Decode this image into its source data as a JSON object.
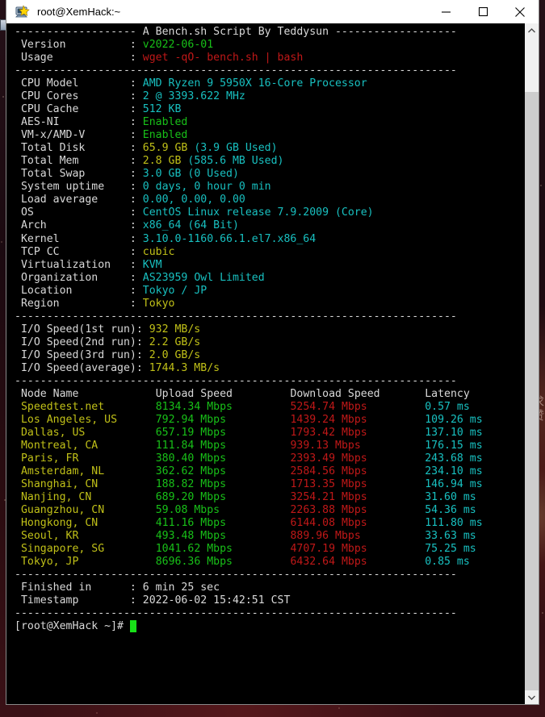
{
  "window": {
    "title": "root@XemHack:~",
    "icon": "putty-icon",
    "minimize_label": "—",
    "maximize_label": "☐",
    "close_label": "✕"
  },
  "wallpaper": {
    "watermark": "求\n赞"
  },
  "scrollbar": {
    "up_arrow": "⌃",
    "down_arrow": "⌄"
  },
  "terminal": {
    "header": {
      "separator": "-------------------",
      "title": "A Bench.sh Script By Teddysun"
    },
    "meta": [
      {
        "label": "Version",
        "value": "v2022-06-01",
        "color": "grn"
      },
      {
        "label": "Usage",
        "value": "wget -qO- bench.sh | bash",
        "color": "red"
      }
    ],
    "sysinfo": [
      {
        "label": "CPU Model",
        "value": "AMD Ryzen 9 5950X 16-Core Processor",
        "color": "cyn"
      },
      {
        "label": "CPU Cores",
        "value": "2 @ 3393.622 MHz",
        "color": "cyn"
      },
      {
        "label": "CPU Cache",
        "value": "512 KB",
        "color": "cyn"
      },
      {
        "label": "AES-NI",
        "value": "Enabled",
        "color": "grn"
      },
      {
        "label": "VM-x/AMD-V",
        "value": "Enabled",
        "color": "grn"
      },
      {
        "label": "Total Disk",
        "value": "65.9 GB",
        "color": "yel",
        "extra": "(3.9 GB Used)",
        "extra_color": "cyn"
      },
      {
        "label": "Total Mem",
        "value": "2.8 GB",
        "color": "yel",
        "extra": "(585.6 MB Used)",
        "extra_color": "cyn"
      },
      {
        "label": "Total Swap",
        "value": "3.0 GB (0 Used)",
        "color": "cyn"
      },
      {
        "label": "System uptime",
        "value": "0 days, 0 hour 0 min",
        "color": "cyn"
      },
      {
        "label": "Load average",
        "value": "0.00, 0.00, 0.00",
        "color": "cyn"
      },
      {
        "label": "OS",
        "value": "CentOS Linux release 7.9.2009 (Core)",
        "color": "cyn"
      },
      {
        "label": "Arch",
        "value": "x86_64 (64 Bit)",
        "color": "cyn"
      },
      {
        "label": "Kernel",
        "value": "3.10.0-1160.66.1.el7.x86_64",
        "color": "cyn"
      },
      {
        "label": "TCP CC",
        "value": "cubic",
        "color": "yel"
      },
      {
        "label": "Virtualization",
        "value": "KVM",
        "color": "cyn"
      },
      {
        "label": "Organization",
        "value": "AS23959 Owl Limited",
        "color": "cyn"
      },
      {
        "label": "Location",
        "value": "Tokyo / JP",
        "color": "cyn"
      },
      {
        "label": "Region",
        "value": "Tokyo",
        "color": "yel"
      }
    ],
    "io_speed": [
      {
        "label": "I/O Speed(1st run)",
        "value": "932 MB/s",
        "color": "yel"
      },
      {
        "label": "I/O Speed(2nd run)",
        "value": "2.2 GB/s",
        "color": "yel"
      },
      {
        "label": "I/O Speed(3rd run)",
        "value": "2.0 GB/s",
        "color": "yel"
      },
      {
        "label": "I/O Speed(average)",
        "value": "1744.3 MB/s",
        "color": "yel"
      }
    ],
    "speedtest": {
      "columns": [
        "Node Name",
        "Upload Speed",
        "Download Speed",
        "Latency"
      ],
      "rows": [
        {
          "node": "Speedtest.net",
          "upload": "8134.34 Mbps",
          "download": "5254.74 Mbps",
          "latency": "0.57 ms"
        },
        {
          "node": "Los Angeles, US",
          "upload": "792.94 Mbps",
          "download": "1439.24 Mbps",
          "latency": "109.26 ms"
        },
        {
          "node": "Dallas, US",
          "upload": "657.19 Mbps",
          "download": "1793.42 Mbps",
          "latency": "137.10 ms"
        },
        {
          "node": "Montreal, CA",
          "upload": "111.84 Mbps",
          "download": "939.13 Mbps",
          "latency": "176.15 ms"
        },
        {
          "node": "Paris, FR",
          "upload": "380.40 Mbps",
          "download": "2393.49 Mbps",
          "latency": "243.68 ms"
        },
        {
          "node": "Amsterdam, NL",
          "upload": "362.62 Mbps",
          "download": "2584.56 Mbps",
          "latency": "234.10 ms"
        },
        {
          "node": "Shanghai, CN",
          "upload": "188.82 Mbps",
          "download": "1713.35 Mbps",
          "latency": "146.94 ms"
        },
        {
          "node": "Nanjing, CN",
          "upload": "689.20 Mbps",
          "download": "3254.21 Mbps",
          "latency": "31.60 ms"
        },
        {
          "node": "Guangzhou, CN",
          "upload": "59.08 Mbps",
          "download": "2263.88 Mbps",
          "latency": "54.36 ms"
        },
        {
          "node": "Hongkong, CN",
          "upload": "411.16 Mbps",
          "download": "6144.08 Mbps",
          "latency": "111.80 ms"
        },
        {
          "node": "Seoul, KR",
          "upload": "493.48 Mbps",
          "download": "889.96 Mbps",
          "latency": "33.63 ms"
        },
        {
          "node": "Singapore, SG",
          "upload": "1041.62 Mbps",
          "download": "4707.19 Mbps",
          "latency": "75.25 ms"
        },
        {
          "node": "Tokyo, JP",
          "upload": "8696.36 Mbps",
          "download": "6432.64 Mbps",
          "latency": "0.85 ms"
        }
      ]
    },
    "footer": [
      {
        "label": "Finished in",
        "value": "6 min 25 sec"
      },
      {
        "label": "Timestamp",
        "value": "2022-06-02 15:42:51 CST"
      }
    ],
    "prompt": "[root@XemHack ~]# ",
    "cursor": " "
  }
}
